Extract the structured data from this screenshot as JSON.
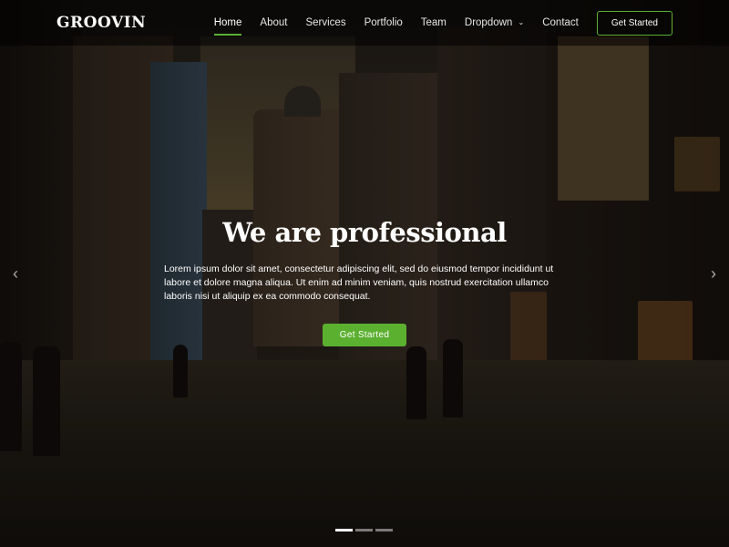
{
  "header": {
    "logo": "GROOVIN",
    "nav": [
      {
        "label": "Home",
        "active": true
      },
      {
        "label": "About",
        "active": false
      },
      {
        "label": "Services",
        "active": false
      },
      {
        "label": "Portfolio",
        "active": false
      },
      {
        "label": "Team",
        "active": false
      },
      {
        "label": "Dropdown",
        "active": false,
        "has_dropdown": true
      },
      {
        "label": "Contact",
        "active": false
      }
    ],
    "cta_label": "Get Started"
  },
  "hero": {
    "title": "We are professional",
    "text": "Lorem ipsum dolor sit amet, consectetur adipiscing elit, sed do eiusmod tempor incididunt ut labore et dolore magna aliqua. Ut enim ad minim veniam, quis nostrud exercitation ullamco laboris nisi ut aliquip ex ea commodo consequat.",
    "button_label": "Get Started",
    "prev_glyph": "‹",
    "next_glyph": "›",
    "slide_count": 3,
    "active_slide": 1
  },
  "icons": {
    "dropdown": "chevron-down-icon",
    "prev": "chevron-left-icon",
    "next": "chevron-right-icon"
  },
  "colors": {
    "accent": "#5cb030",
    "header_bg": "#000000"
  }
}
